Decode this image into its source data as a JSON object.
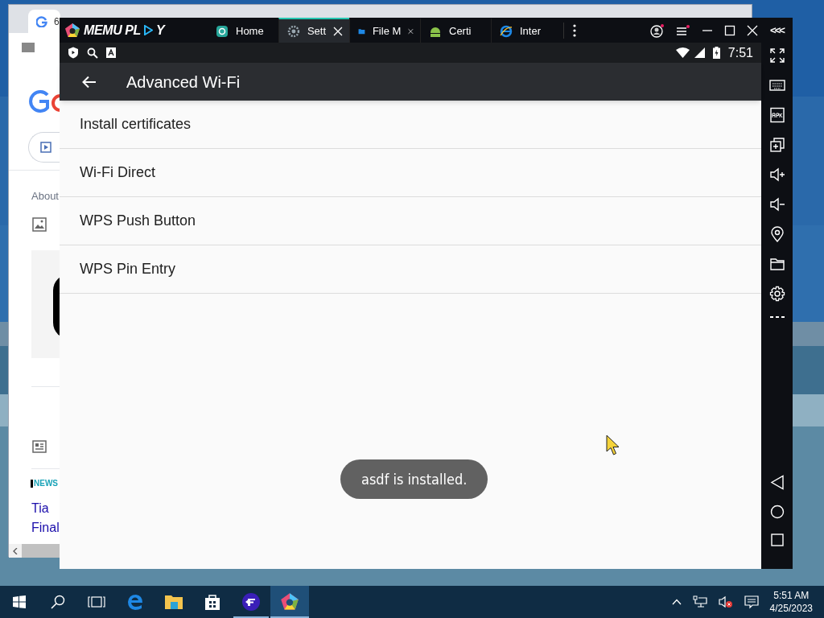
{
  "background_browser": {
    "tabs": [
      {
        "label": "6",
        "selected": true
      }
    ],
    "about": "About",
    "news_source": "NEWS",
    "headline_lines": [
      "Tia",
      "Final"
    ]
  },
  "emulator": {
    "logo_parts": [
      "MEMU PL",
      "Y"
    ],
    "tabs": [
      {
        "label": "Home",
        "selected": false,
        "closable": false
      },
      {
        "label": "Sett",
        "selected": true,
        "closable": true
      },
      {
        "label": "File M",
        "selected": false,
        "closable": true
      },
      {
        "label": "Certi",
        "selected": false,
        "closable": false
      },
      {
        "label": "Inter",
        "selected": false,
        "closable": false
      }
    ],
    "collapse_label": "<<<",
    "status_bar": {
      "time": "7:51"
    },
    "app_bar": {
      "title": "Advanced Wi-Fi"
    },
    "settings_items": [
      {
        "label": "Install certificates"
      },
      {
        "label": "Wi-Fi Direct"
      },
      {
        "label": "WPS Push Button"
      },
      {
        "label": "WPS Pin Entry"
      }
    ],
    "toast": "asdf is installed."
  },
  "taskbar": {
    "time": "5:51 AM",
    "date": "4/25/2023"
  }
}
